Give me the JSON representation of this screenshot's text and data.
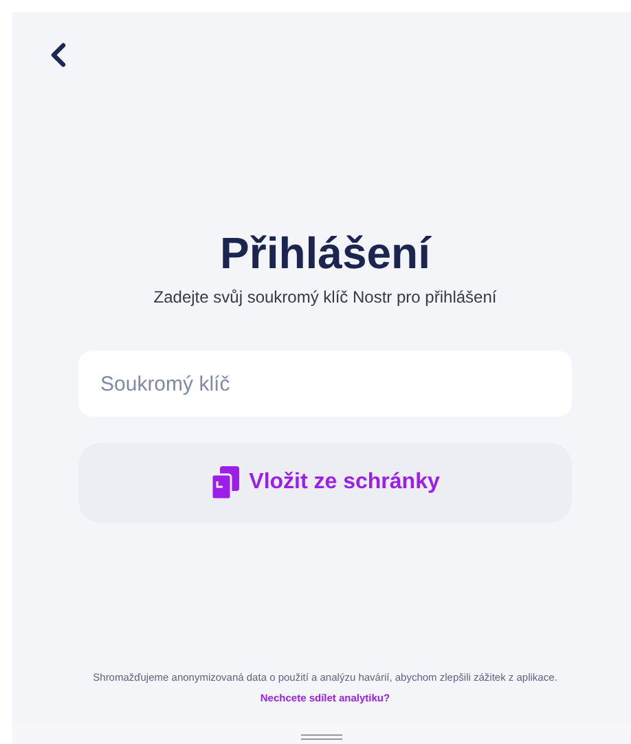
{
  "title": "Přihlášení",
  "subtitle": "Zadejte svůj soukromý klíč Nostr pro přihlášení",
  "key_field": {
    "placeholder": "Soukromý klíč"
  },
  "paste_button": {
    "label": "Vložit ze schránky"
  },
  "footer": {
    "text": "Shromažďujeme anonymizovaná data o použití a analýzu havárií, abychom zlepšili zážitek z aplikace.",
    "link": "Nechcete sdílet analytiku?"
  }
}
